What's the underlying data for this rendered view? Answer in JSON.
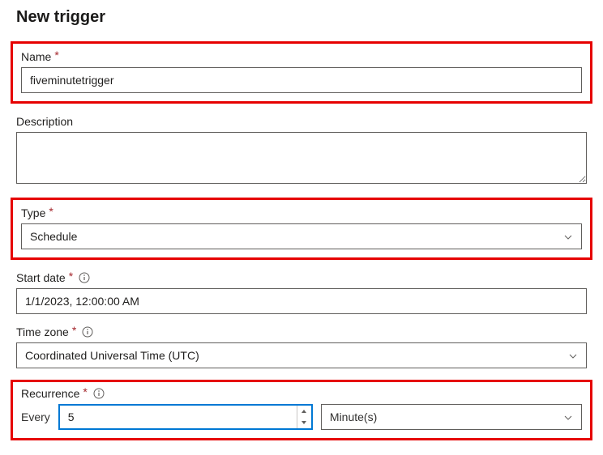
{
  "title": "New trigger",
  "name": {
    "label": "Name",
    "required": "*",
    "value": "fiveminutetrigger"
  },
  "description": {
    "label": "Description",
    "value": ""
  },
  "type": {
    "label": "Type",
    "required": "*",
    "value": "Schedule"
  },
  "start_date": {
    "label": "Start date",
    "required": "*",
    "value": "1/1/2023, 12:00:00 AM"
  },
  "time_zone": {
    "label": "Time zone",
    "required": "*",
    "value": "Coordinated Universal Time (UTC)"
  },
  "recurrence": {
    "label": "Recurrence",
    "required": "*",
    "every_label": "Every",
    "every_value": "5",
    "unit": "Minute(s)"
  }
}
